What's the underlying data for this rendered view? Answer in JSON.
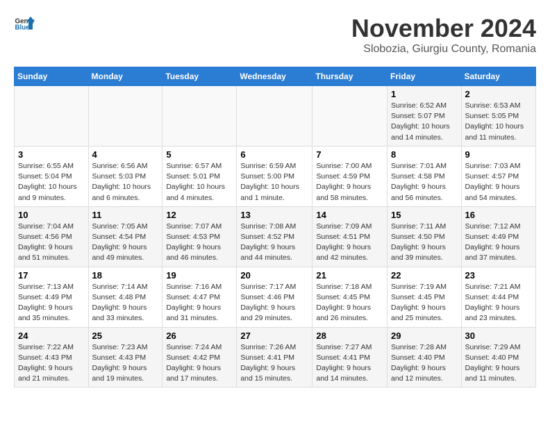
{
  "logo": {
    "general": "General",
    "blue": "Blue"
  },
  "header": {
    "month": "November 2024",
    "location": "Slobozia, Giurgiu County, Romania"
  },
  "days_of_week": [
    "Sunday",
    "Monday",
    "Tuesday",
    "Wednesday",
    "Thursday",
    "Friday",
    "Saturday"
  ],
  "weeks": [
    [
      {
        "day": "",
        "info": ""
      },
      {
        "day": "",
        "info": ""
      },
      {
        "day": "",
        "info": ""
      },
      {
        "day": "",
        "info": ""
      },
      {
        "day": "",
        "info": ""
      },
      {
        "day": "1",
        "info": "Sunrise: 6:52 AM\nSunset: 5:07 PM\nDaylight: 10 hours and 14 minutes."
      },
      {
        "day": "2",
        "info": "Sunrise: 6:53 AM\nSunset: 5:05 PM\nDaylight: 10 hours and 11 minutes."
      }
    ],
    [
      {
        "day": "3",
        "info": "Sunrise: 6:55 AM\nSunset: 5:04 PM\nDaylight: 10 hours and 9 minutes."
      },
      {
        "day": "4",
        "info": "Sunrise: 6:56 AM\nSunset: 5:03 PM\nDaylight: 10 hours and 6 minutes."
      },
      {
        "day": "5",
        "info": "Sunrise: 6:57 AM\nSunset: 5:01 PM\nDaylight: 10 hours and 4 minutes."
      },
      {
        "day": "6",
        "info": "Sunrise: 6:59 AM\nSunset: 5:00 PM\nDaylight: 10 hours and 1 minute."
      },
      {
        "day": "7",
        "info": "Sunrise: 7:00 AM\nSunset: 4:59 PM\nDaylight: 9 hours and 58 minutes."
      },
      {
        "day": "8",
        "info": "Sunrise: 7:01 AM\nSunset: 4:58 PM\nDaylight: 9 hours and 56 minutes."
      },
      {
        "day": "9",
        "info": "Sunrise: 7:03 AM\nSunset: 4:57 PM\nDaylight: 9 hours and 54 minutes."
      }
    ],
    [
      {
        "day": "10",
        "info": "Sunrise: 7:04 AM\nSunset: 4:56 PM\nDaylight: 9 hours and 51 minutes."
      },
      {
        "day": "11",
        "info": "Sunrise: 7:05 AM\nSunset: 4:54 PM\nDaylight: 9 hours and 49 minutes."
      },
      {
        "day": "12",
        "info": "Sunrise: 7:07 AM\nSunset: 4:53 PM\nDaylight: 9 hours and 46 minutes."
      },
      {
        "day": "13",
        "info": "Sunrise: 7:08 AM\nSunset: 4:52 PM\nDaylight: 9 hours and 44 minutes."
      },
      {
        "day": "14",
        "info": "Sunrise: 7:09 AM\nSunset: 4:51 PM\nDaylight: 9 hours and 42 minutes."
      },
      {
        "day": "15",
        "info": "Sunrise: 7:11 AM\nSunset: 4:50 PM\nDaylight: 9 hours and 39 minutes."
      },
      {
        "day": "16",
        "info": "Sunrise: 7:12 AM\nSunset: 4:49 PM\nDaylight: 9 hours and 37 minutes."
      }
    ],
    [
      {
        "day": "17",
        "info": "Sunrise: 7:13 AM\nSunset: 4:49 PM\nDaylight: 9 hours and 35 minutes."
      },
      {
        "day": "18",
        "info": "Sunrise: 7:14 AM\nSunset: 4:48 PM\nDaylight: 9 hours and 33 minutes."
      },
      {
        "day": "19",
        "info": "Sunrise: 7:16 AM\nSunset: 4:47 PM\nDaylight: 9 hours and 31 minutes."
      },
      {
        "day": "20",
        "info": "Sunrise: 7:17 AM\nSunset: 4:46 PM\nDaylight: 9 hours and 29 minutes."
      },
      {
        "day": "21",
        "info": "Sunrise: 7:18 AM\nSunset: 4:45 PM\nDaylight: 9 hours and 26 minutes."
      },
      {
        "day": "22",
        "info": "Sunrise: 7:19 AM\nSunset: 4:45 PM\nDaylight: 9 hours and 25 minutes."
      },
      {
        "day": "23",
        "info": "Sunrise: 7:21 AM\nSunset: 4:44 PM\nDaylight: 9 hours and 23 minutes."
      }
    ],
    [
      {
        "day": "24",
        "info": "Sunrise: 7:22 AM\nSunset: 4:43 PM\nDaylight: 9 hours and 21 minutes."
      },
      {
        "day": "25",
        "info": "Sunrise: 7:23 AM\nSunset: 4:43 PM\nDaylight: 9 hours and 19 minutes."
      },
      {
        "day": "26",
        "info": "Sunrise: 7:24 AM\nSunset: 4:42 PM\nDaylight: 9 hours and 17 minutes."
      },
      {
        "day": "27",
        "info": "Sunrise: 7:26 AM\nSunset: 4:41 PM\nDaylight: 9 hours and 15 minutes."
      },
      {
        "day": "28",
        "info": "Sunrise: 7:27 AM\nSunset: 4:41 PM\nDaylight: 9 hours and 14 minutes."
      },
      {
        "day": "29",
        "info": "Sunrise: 7:28 AM\nSunset: 4:40 PM\nDaylight: 9 hours and 12 minutes."
      },
      {
        "day": "30",
        "info": "Sunrise: 7:29 AM\nSunset: 4:40 PM\nDaylight: 9 hours and 11 minutes."
      }
    ]
  ]
}
